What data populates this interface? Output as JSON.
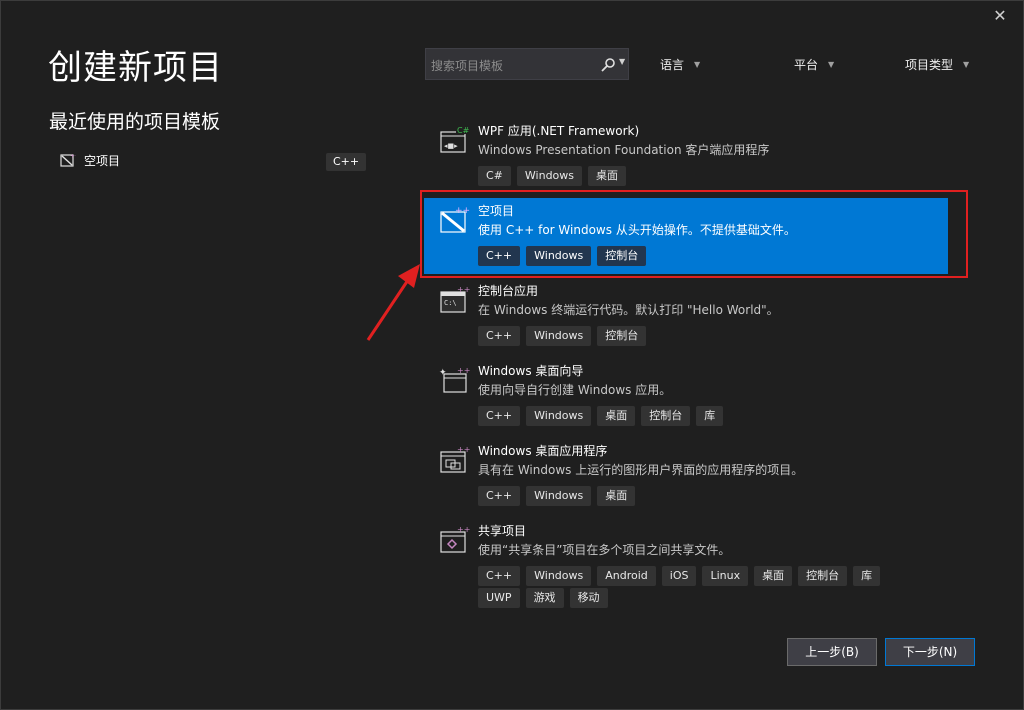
{
  "window": {
    "close_glyph": "✕"
  },
  "page_title": "创建新项目",
  "recent": {
    "title": "最近使用的项目模板",
    "items": [
      {
        "label": "空项目",
        "tag": "C++",
        "icon": "empty-project-icon"
      }
    ]
  },
  "search": {
    "placeholder": "搜索项目模板",
    "icon": "search-icon"
  },
  "filters": [
    {
      "label": "语言"
    },
    {
      "label": "平台"
    },
    {
      "label": "项目类型"
    }
  ],
  "templates": [
    {
      "name": "WPF 应用(.NET Framework)",
      "desc": "Windows Presentation Foundation 客户端应用程序",
      "tags": [
        "C#",
        "Windows",
        "桌面"
      ],
      "icon": "wpf-app-icon"
    },
    {
      "name": "空项目",
      "desc": "使用 C++ for Windows 从头开始操作。不提供基础文件。",
      "tags": [
        "C++",
        "Windows",
        "控制台"
      ],
      "icon": "empty-project-icon",
      "selected": true
    },
    {
      "name": "控制台应用",
      "desc": "在 Windows 终端运行代码。默认打印 \"Hello World\"。",
      "tags": [
        "C++",
        "Windows",
        "控制台"
      ],
      "icon": "console-app-icon"
    },
    {
      "name": "Windows 桌面向导",
      "desc": "使用向导自行创建 Windows 应用。",
      "tags": [
        "C++",
        "Windows",
        "桌面",
        "控制台",
        "库"
      ],
      "icon": "desktop-wizard-icon"
    },
    {
      "name": "Windows 桌面应用程序",
      "desc": "具有在 Windows 上运行的图形用户界面的应用程序的项目。",
      "tags": [
        "C++",
        "Windows",
        "桌面"
      ],
      "icon": "desktop-app-icon"
    },
    {
      "name": "共享项目",
      "desc": "使用“共享条目”项目在多个项目之间共享文件。",
      "tags": [
        "C++",
        "Windows",
        "Android",
        "iOS",
        "Linux",
        "桌面",
        "控制台",
        "库",
        "UWP",
        "游戏",
        "移动"
      ],
      "icon": "shared-project-icon"
    }
  ],
  "buttons": {
    "back": "上一步(B)",
    "next": "下一步(N)"
  },
  "colors": {
    "background": "#1f1f1f",
    "selected": "#0078d4",
    "highlight_box": "#e02020"
  }
}
